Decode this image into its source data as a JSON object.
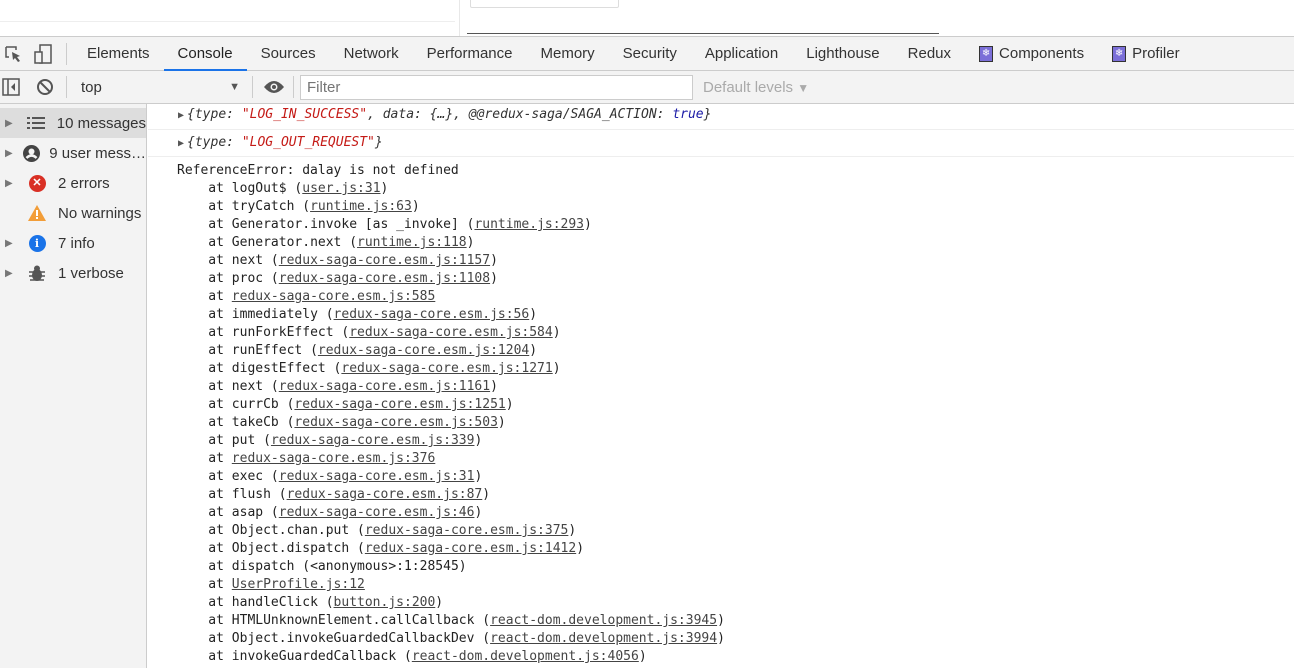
{
  "devtools": {
    "tabs": [
      {
        "label": "Elements"
      },
      {
        "label": "Console",
        "active": true
      },
      {
        "label": "Sources"
      },
      {
        "label": "Network"
      },
      {
        "label": "Performance"
      },
      {
        "label": "Memory"
      },
      {
        "label": "Security"
      },
      {
        "label": "Application"
      },
      {
        "label": "Lighthouse"
      },
      {
        "label": "Redux"
      },
      {
        "label": "Components",
        "icon": "react-icon"
      },
      {
        "label": "Profiler",
        "icon": "react-icon"
      }
    ],
    "toolbar": {
      "context": "top",
      "filter_placeholder": "Filter",
      "levels": "Default levels"
    },
    "sidebar": [
      {
        "label": "10 messages",
        "icon": "list-icon",
        "selected": true
      },
      {
        "label": "9 user mess…",
        "icon": "user-icon"
      },
      {
        "label": "2 errors",
        "icon": "error-icon"
      },
      {
        "label": "No warnings",
        "icon": "warning-icon"
      },
      {
        "label": "7 info",
        "icon": "info-icon"
      },
      {
        "label": "1 verbose",
        "icon": "bug-icon"
      }
    ]
  },
  "console": {
    "msg1": {
      "open": "{type: ",
      "type": "\"LOG_IN_SUCCESS\"",
      "mid": ", data: {…}, @@redux-saga/SAGA_ACTION: ",
      "val": "true",
      "close": "}"
    },
    "msg2": {
      "open": "{type: ",
      "type": "\"LOG_OUT_REQUEST\"",
      "close": "}"
    },
    "error_title": "ReferenceError: dalay is not defined",
    "stack": [
      {
        "fn": "logOut$",
        "link": "user.js:31"
      },
      {
        "fn": "tryCatch",
        "link": "runtime.js:63"
      },
      {
        "fn": "Generator.invoke [as _invoke]",
        "link": "runtime.js:293"
      },
      {
        "fn": "Generator.next",
        "link": "runtime.js:118"
      },
      {
        "fn": "next",
        "link": "redux-saga-core.esm.js:1157"
      },
      {
        "fn": "proc",
        "link": "redux-saga-core.esm.js:1108"
      },
      {
        "fn": "",
        "link": "redux-saga-core.esm.js:585"
      },
      {
        "fn": "immediately",
        "link": "redux-saga-core.esm.js:56"
      },
      {
        "fn": "runForkEffect",
        "link": "redux-saga-core.esm.js:584"
      },
      {
        "fn": "runEffect",
        "link": "redux-saga-core.esm.js:1204"
      },
      {
        "fn": "digestEffect",
        "link": "redux-saga-core.esm.js:1271"
      },
      {
        "fn": "next",
        "link": "redux-saga-core.esm.js:1161"
      },
      {
        "fn": "currCb",
        "link": "redux-saga-core.esm.js:1251"
      },
      {
        "fn": "takeCb",
        "link": "redux-saga-core.esm.js:503"
      },
      {
        "fn": "put",
        "link": "redux-saga-core.esm.js:339"
      },
      {
        "fn": "",
        "link": "redux-saga-core.esm.js:376"
      },
      {
        "fn": "exec",
        "link": "redux-saga-core.esm.js:31"
      },
      {
        "fn": "flush",
        "link": "redux-saga-core.esm.js:87"
      },
      {
        "fn": "asap",
        "link": "redux-saga-core.esm.js:46"
      },
      {
        "fn": "Object.chan.put",
        "link": "redux-saga-core.esm.js:375"
      },
      {
        "fn": "Object.dispatch",
        "link": "redux-saga-core.esm.js:1412"
      },
      {
        "fn": "dispatch (<anonymous>:1:28545)",
        "link": null
      },
      {
        "fn": "",
        "link": "UserProfile.js:12"
      },
      {
        "fn": "handleClick",
        "link": "button.js:200"
      },
      {
        "fn": "HTMLUnknownElement.callCallback",
        "link": "react-dom.development.js:3945"
      },
      {
        "fn": "Object.invokeGuardedCallbackDev",
        "link": "react-dom.development.js:3994"
      },
      {
        "fn": "invokeGuardedCallback",
        "link": "react-dom.development.js:4056"
      }
    ]
  }
}
